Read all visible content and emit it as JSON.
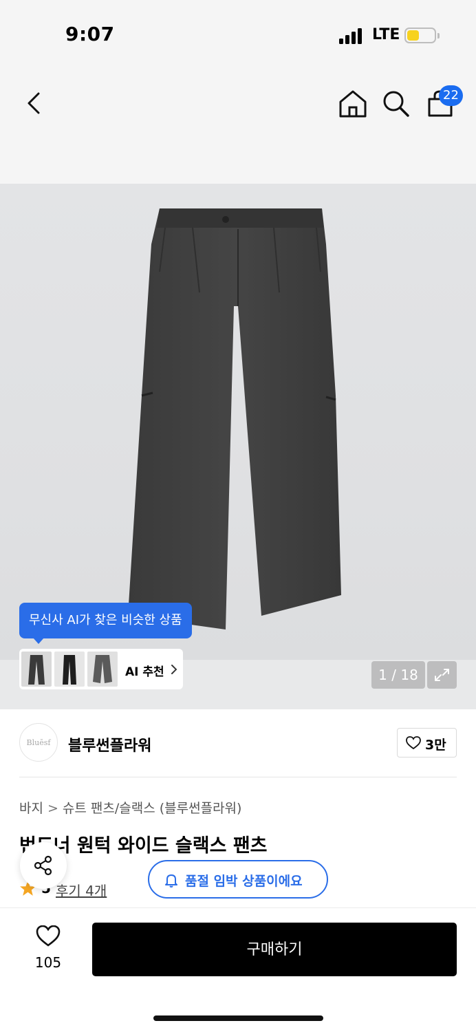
{
  "status_bar": {
    "time": "9:07",
    "network": "LTE"
  },
  "nav": {
    "icons": [
      "chevron-left-icon",
      "home-icon",
      "search-icon",
      "shopping-bag-icon"
    ],
    "cart_count": "22"
  },
  "gallery": {
    "ai_tooltip": "무신사 AI가 찾은 비슷한 상품",
    "ai_recommend_label": "AI 추천",
    "counter": "1 / 18"
  },
  "brand": {
    "logo_text": "Bluēsf",
    "name": "블루썬플라워",
    "likes": "3만"
  },
  "product": {
    "breadcrumb": [
      "바지",
      "슈트 팬츠/슬랙스 (블루썬플라워)"
    ],
    "title": "번드너 원턱 와이드 슬랙스 팬츠",
    "rating": "5",
    "reviews": "후기 4개",
    "soldout_notice": "품절 임박 상품이에요"
  },
  "bottom_bar": {
    "wish_count": "105",
    "buy_label": "구매하기"
  },
  "colors": {
    "accent_blue": "#2a6de8",
    "badge_blue": "#1a6cf0",
    "star": "#f5a623",
    "battery": "#f7d21e"
  }
}
